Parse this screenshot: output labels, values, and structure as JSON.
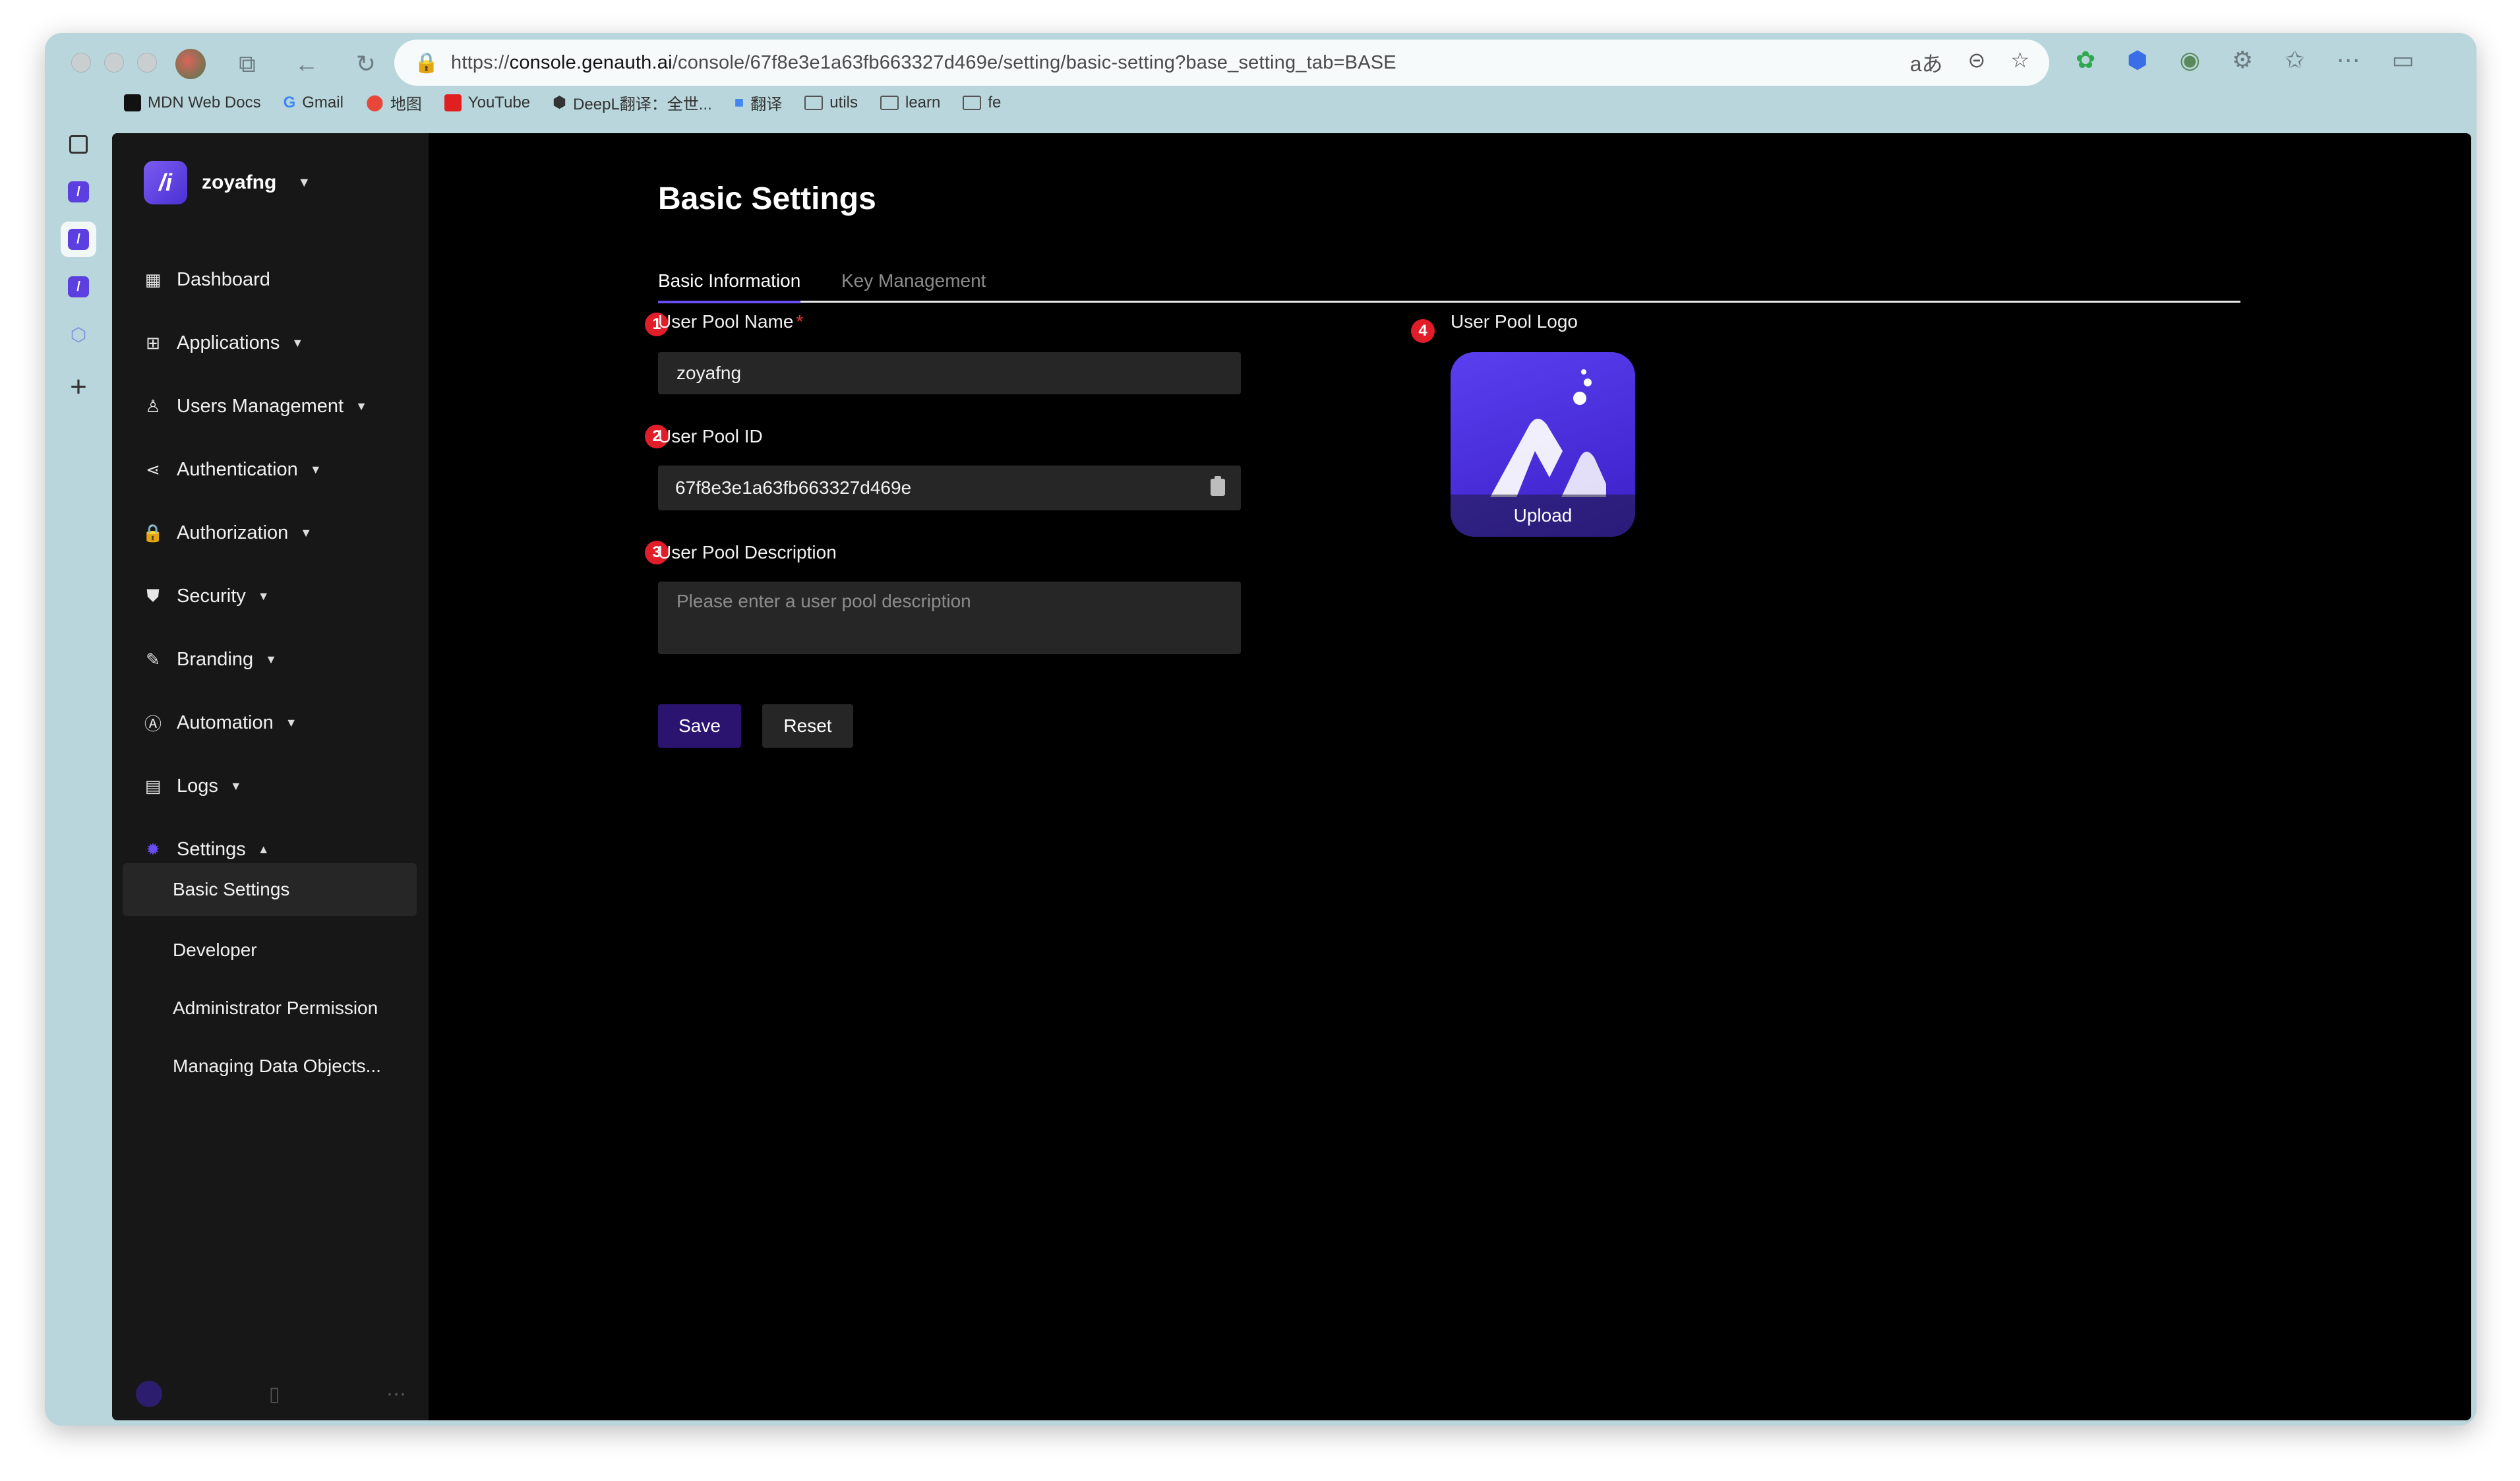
{
  "browser": {
    "url_prefix": "https://",
    "url_domain": "console.genauth.ai",
    "url_path": "/console/67f8e3e1a63fb663327d469e/setting/basic-setting?base_setting_tab=BASE",
    "translate_glyph": "aあ",
    "bookmarks": [
      {
        "label": "MDN Web Docs"
      },
      {
        "label": "Gmail"
      },
      {
        "label": "地图"
      },
      {
        "label": "YouTube"
      },
      {
        "label": "DeepL翻译：全世..."
      },
      {
        "label": "翻译"
      },
      {
        "label": "utils"
      },
      {
        "label": "learn"
      },
      {
        "label": "fe"
      }
    ]
  },
  "sidebar": {
    "brand": "zoyafng",
    "items": [
      {
        "label": "Dashboard",
        "icon": "dashboard-icon"
      },
      {
        "label": "Applications",
        "icon": "applications-icon"
      },
      {
        "label": "Users Management",
        "icon": "user-icon"
      },
      {
        "label": "Authentication",
        "icon": "share-icon"
      },
      {
        "label": "Authorization",
        "icon": "lock-icon"
      },
      {
        "label": "Security",
        "icon": "shield-icon"
      },
      {
        "label": "Branding",
        "icon": "brush-icon"
      },
      {
        "label": "Automation",
        "icon": "automation-icon"
      },
      {
        "label": "Logs",
        "icon": "logs-icon"
      },
      {
        "label": "Settings",
        "icon": "gear-icon"
      }
    ],
    "settings_sub": [
      {
        "label": "Basic Settings"
      },
      {
        "label": "Developer"
      },
      {
        "label": "Administrator Permission"
      },
      {
        "label": "Managing Data Objects..."
      }
    ]
  },
  "main": {
    "title": "Basic Settings",
    "tabs": [
      {
        "label": "Basic Information"
      },
      {
        "label": "Key Management"
      }
    ],
    "badges": [
      "1",
      "2",
      "3",
      "4"
    ],
    "pool_name_label": "User Pool Name",
    "required_mark": "*",
    "pool_name_value": "zoyafng",
    "pool_id_label": "User Pool ID",
    "pool_id_value": "67f8e3e1a63fb663327d469e",
    "description_label": "User Pool Description",
    "description_placeholder": "Please enter a user pool description",
    "save_label": "Save",
    "reset_label": "Reset",
    "logo_label": "User Pool Logo",
    "upload_label": "Upload"
  },
  "colors": {
    "accent": "#6a4cf5",
    "save_button": "#2a1470",
    "badge": "#e11d2a",
    "app_background": "#000000",
    "sidebar_background": "#171717"
  }
}
